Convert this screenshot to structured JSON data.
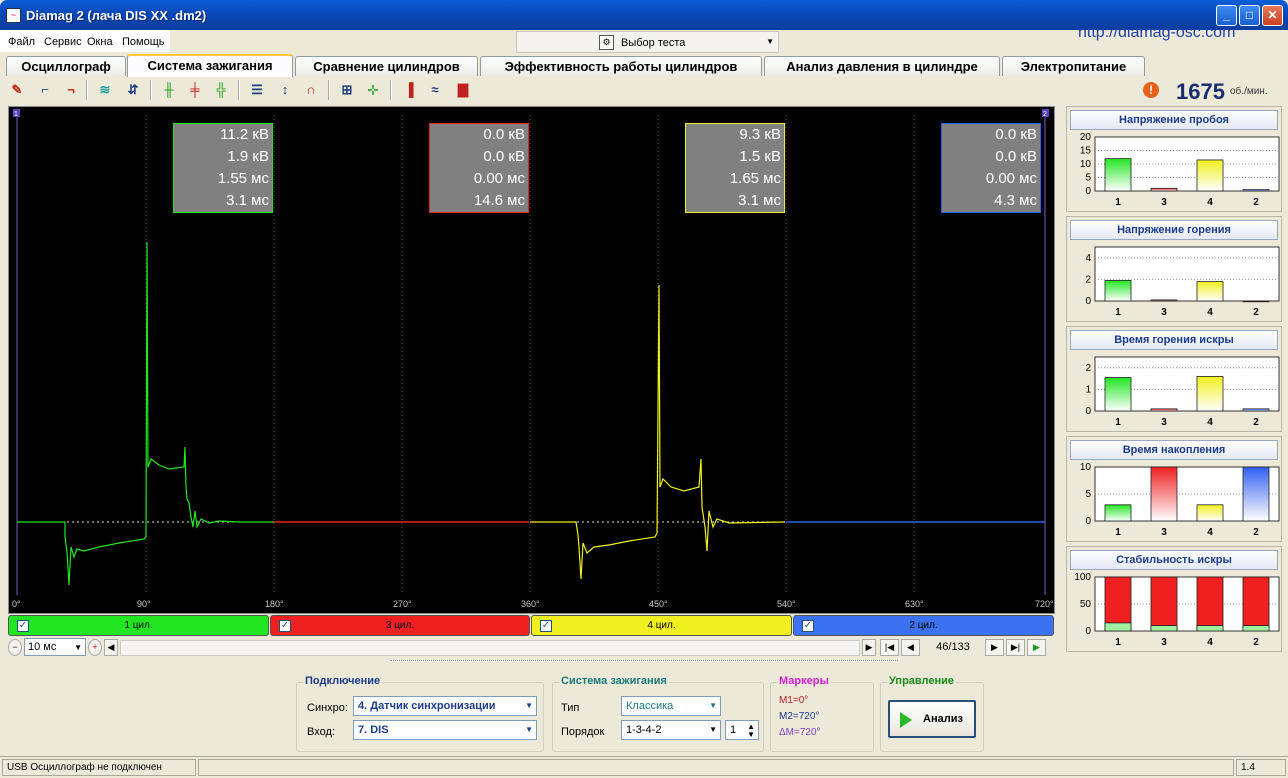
{
  "window": {
    "title": "Diamag 2 (лача DIS  XX .dm2)",
    "url": "http://diamag-osc.com"
  },
  "menu": [
    "Файл",
    "Сервис",
    "Окна",
    "Помощь"
  ],
  "test_select": "Выбор теста",
  "tabs": [
    {
      "label": "Осциллограф",
      "active": false
    },
    {
      "label": "Система зажигания",
      "active": true
    },
    {
      "label": "Сравнение цилиндров",
      "active": false
    },
    {
      "label": "Эффективность работы цилиндров",
      "active": false
    },
    {
      "label": "Анализ давления в цилиндре",
      "active": false
    },
    {
      "label": "Электропитание",
      "active": false
    }
  ],
  "rpm": {
    "value": "1675",
    "unit": "об./мин."
  },
  "scope": {
    "x_ticks": [
      "0°",
      "90°",
      "180°",
      "270°",
      "360°",
      "450°",
      "540°",
      "630°",
      "720°"
    ],
    "marker_labels": [
      "1",
      "2"
    ],
    "readouts": [
      {
        "color": "#22e622",
        "values": [
          "11.2 кВ",
          "1.9 кВ",
          "1.55 мс",
          "3.1 мс"
        ]
      },
      {
        "color": "#ee2020",
        "values": [
          "0.0 кВ",
          "0.0 кВ",
          "0.00 мс",
          "14.6 мс"
        ]
      },
      {
        "color": "#f0f020",
        "values": [
          "9.3 кВ",
          "1.5 кВ",
          "1.65 мс",
          "3.1 мс"
        ]
      },
      {
        "color": "#3060f0",
        "values": [
          "0.0 кВ",
          "0.0 кВ",
          "0.00 мс",
          "4.3 мс"
        ]
      }
    ]
  },
  "cylinders": [
    {
      "label": "1 цил.",
      "color": "#22e622"
    },
    {
      "label": "3 цил.",
      "color": "#ee2020"
    },
    {
      "label": "4 цил.",
      "color": "#f0f020"
    },
    {
      "label": "2 цил.",
      "color": "#3c72f0"
    }
  ],
  "nav": {
    "timebase": "10 мс",
    "frame": "46/133"
  },
  "connection": {
    "title": "Подключение",
    "sync_label": "Синхро:",
    "sync_value": "4.  Датчик синхронизации",
    "input_label": "Вход:",
    "input_value": "7.  DIS"
  },
  "ignition": {
    "title": "Система зажигания",
    "type_label": "Тип",
    "type_value": "Классика",
    "order_label": "Порядок",
    "order_value": "1-3-4-2",
    "order_step": "1"
  },
  "markers": {
    "title": "Маркеры",
    "m1": "M1=0°",
    "m2": "M2=720°",
    "dm": "ΔM=720°"
  },
  "control": {
    "title": "Управление",
    "analyze_label": "Анализ"
  },
  "status": {
    "message": "USB Осциллограф не подключен",
    "version": "1.4"
  },
  "right_panel": [
    {
      "title": "Напряжение пробоя",
      "type": "bar",
      "categories": [
        "1",
        "3",
        "4",
        "2"
      ],
      "values": [
        12,
        1,
        11.5,
        0.5
      ],
      "yticks": [
        "20",
        "15",
        "10",
        "5",
        "0"
      ],
      "ylim": [
        0,
        20
      ],
      "colors": [
        "#22e622",
        "#ee2020",
        "#f0f020",
        "#3060f0"
      ]
    },
    {
      "title": "Напряжение горения",
      "type": "bar",
      "categories": [
        "1",
        "3",
        "4",
        "2"
      ],
      "values": [
        1.9,
        0.1,
        1.8,
        0
      ],
      "yticks": [
        "4",
        "2",
        "0"
      ],
      "ylim": [
        0,
        5
      ],
      "colors": [
        "#22e622",
        "#ee2020",
        "#f0f020",
        "#3060f0"
      ]
    },
    {
      "title": "Время горения искры",
      "type": "bar",
      "categories": [
        "1",
        "3",
        "4",
        "2"
      ],
      "values": [
        1.55,
        0.1,
        1.6,
        0.1
      ],
      "yticks": [
        "2",
        "1",
        "0"
      ],
      "ylim": [
        0,
        2.5
      ],
      "colors": [
        "#22e622",
        "#ee2020",
        "#f0f020",
        "#3060f0"
      ]
    },
    {
      "title": "Время накопления",
      "type": "bar",
      "categories": [
        "1",
        "3",
        "4",
        "2"
      ],
      "values": [
        3,
        10,
        3,
        10
      ],
      "yticks": [
        "10",
        "5",
        "0"
      ],
      "ylim": [
        0,
        10
      ],
      "colors": [
        "#22e622",
        "#ee2020",
        "#f0f020",
        "#3060f0"
      ]
    },
    {
      "title": "Стабильность искры",
      "type": "bar",
      "categories": [
        "1",
        "3",
        "4",
        "2"
      ],
      "values": [
        100,
        100,
        100,
        100
      ],
      "stable": [
        15,
        10,
        10,
        10
      ],
      "yticks": [
        "100",
        "50",
        "0"
      ],
      "ylim": [
        0,
        100
      ],
      "colors": [
        "#ee2020",
        "#ee2020",
        "#ee2020",
        "#ee2020"
      ]
    }
  ]
}
